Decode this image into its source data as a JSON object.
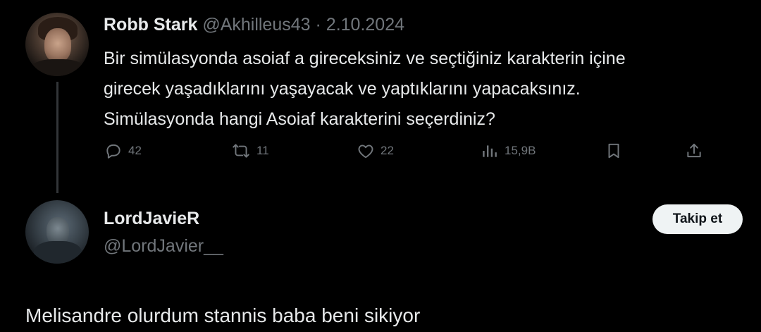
{
  "parent_tweet": {
    "display_name": "Robb Stark",
    "handle": "@Akhilleus43",
    "separator": "·",
    "date": "2.10.2024",
    "text_lines": [
      "Bir simülasyonda asoiaf a gireceksiniz ve seçtiğiniz karakterin içine",
      "girecek yaşadıklarını yaşayacak ve yaptıklarını yapacaksınız.",
      "Simülasyonda hangi Asoiaf karakterini seçerdiniz?"
    ],
    "actions": {
      "replies": "42",
      "reposts": "11",
      "likes": "22",
      "views": "15,9B"
    }
  },
  "reply": {
    "display_name": "LordJavieR",
    "handle": "@LordJavier__",
    "follow_label": "Takip et",
    "text": "Melisandre olurdum stannis baba beni sikiyor"
  },
  "colors": {
    "background": "#000000",
    "primary_text": "#e7e9ea",
    "secondary_text": "#71767b",
    "follow_button_bg": "#eff3f4",
    "thread_line": "#333639"
  },
  "icons": {
    "reply": "reply-icon",
    "repost": "repost-icon",
    "like": "heart-icon",
    "views": "views-icon",
    "bookmark": "bookmark-icon",
    "share": "share-icon"
  }
}
